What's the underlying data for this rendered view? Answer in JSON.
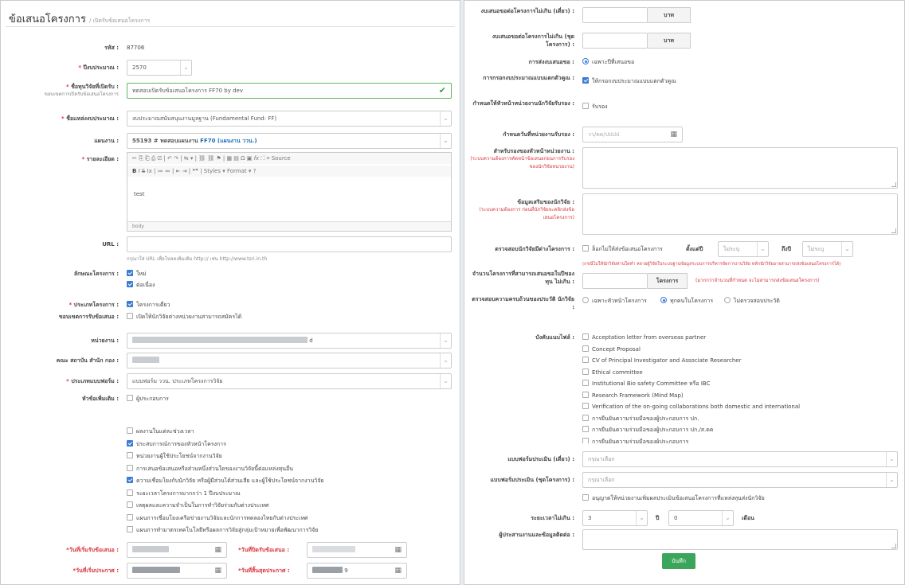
{
  "header": {
    "title": "ข้อเสนอโครงการ",
    "crumb": "/ เปิดรับข้อเสนอโครงการ"
  },
  "form": {
    "id_label": "รหัส :",
    "id_value": "87706",
    "year_label": "ปีงบประมาณ :",
    "year_value": "2570",
    "call_label": "ชื่อทุนวิจัยที่เปิดรับ :",
    "call_sublabel": "ขอบเขตการเปิดรับข้อเสนอโครงการ",
    "call_value": "ทดสอบเปิดรับข้อเสนอโครงการ FF70 by dev",
    "source_label": "ชื่อแหล่งงบประมาณ :",
    "source_value": "งบประมาณสนับสนุนงานมูลฐาน (Fundamental Fund: FF)",
    "plan_label": "แผนงาน :",
    "plan_value": "55193 # ทดสอบแผนงาน",
    "plan_code": "FF70",
    "plan_note": "(แผนงาน ววน.)",
    "detail_label": "รายละเอียด :",
    "toolbar_row1": "✂ ⎘ ⎗ ⎙ ⎚ | ↶ ↷ | ⇆ ▾ | ⛓ ⛓ ⚑ | ▦ ▤ Ω ▣",
    "fx": "fx",
    "source_btn": "⌗ Source",
    "toolbar_b": "B",
    "toolbar_i": "I",
    "toolbar_s": "S",
    "toolbar_rest": "Ix | ≔ ≕ | ⇤ ⇥ | ❝❞ |",
    "styles": "Styles",
    "format": "Format",
    "help": "?",
    "detail_value": "test",
    "detail_footer": "body",
    "url_label": "URL :",
    "url_hint": "กรุณาใส่ URL เพื่อโหลดเพิ่มเติม http:// เช่น http://www.tsri.in.th",
    "nature_label": "ลักษณะโครงการ :",
    "nature_opt1": "ใหม่",
    "nature_opt2": "ต่อเนื่อง",
    "type_label": "ประเภทโครงการ :",
    "type_value": "โครงการเดี่ยว",
    "scope_label": "ขอบเขตการรับข้อเสนอ :",
    "scope_value": "เปิดให้นักวิจัยต่างหน่วยงานสามารถสมัครได้",
    "unit_label": "หน่วยงาน :",
    "unit_suffix": "d",
    "faculty_label": "คณะ สถาบัน สำนัก กอง :",
    "form_label": "ประเภทแบบฟอร์ม :",
    "form_value": "แบบฟอร์ม ววน. ประเภทโครงการวิจัย",
    "extra_label": "หัวข้อเพิ่มเติม :",
    "extra_value": "ผู้ประกอบการ",
    "checks": [
      {
        "text": "ผลงานในแต่ละช่วงเวลา",
        "on": false
      },
      {
        "text": "ประสบการณ์การของหัวหน้าโครงการ",
        "on": true
      },
      {
        "text": "หน่วยงานผู้ใช้ประโยชน์จากงานวิจัย",
        "on": false
      },
      {
        "text": "การเสนอข้อเสนอหรือส่วนหนึ่งส่วนใดของงานวิจัยนี้ต่อแหล่งทุนอื่น",
        "on": false
      },
      {
        "text": "ความเชื่อมโยงกับนักวิจัย หรือผู้มีส่วนได้ส่วนเสีย และผู้ใช้ประโยชน์จากงานวิจัย",
        "on": true
      },
      {
        "text": "ระยะเวลาโครงการมากกว่า 1 ปีงบประมาณ",
        "on": false
      },
      {
        "text": "เหตุผลและความจำเป็นในการทำวิจัยร่วมกับต่างประเทศ",
        "on": false
      },
      {
        "text": "แผนการเชื่อมโยงเครือข่ายงานวิจัยและนักการทดลองไทยกับต่างประเทศ",
        "on": false
      },
      {
        "text": "แผนการทำมาตรเทคโนโลยีหรือผลการวิจัยสู่กลุ่มเป้าหมายเพื่อพัฒนาการวิจัย",
        "on": false
      }
    ],
    "open_label": "*วันที่เริ่มรับข้อเสนอ :",
    "close_label": "*วันที่ปิดรับข้อเสนอ :",
    "start_label": "*วันที่เริ่มประกาศ :",
    "end_label": "*วันที่สิ้นสุดประกาศ :",
    "end_suffix": "9",
    "budget1_label": "งบเสนอขอต่อโครงการไม่เกิน (เดี่ยว) :",
    "budget2_label": "งบเสนอขอต่อโครงการไม่เกิน (ชุดโครงการ) :",
    "baht": "บาท",
    "submit_label": "การส่งงบเสนอขอ :",
    "submit_value": "เฉพาะปีที่เสนอขอ",
    "multi_label": "การกรอกงบประมาณแบบแตกตัวคูณ :",
    "multi_value": "ให้กรอกงบประมาณแบบแตกตัวคูณ",
    "head_label": "กำหนดให้หัวหน้าหน่วยงานนักวิจัยรับรอง :",
    "head_value": "รับรอง",
    "certdate_label": "กำหนดวันที่หน่วยงานรับรอง :",
    "certdate_placeholder": "วว/ดด/ปปปป",
    "hunit_label": "สำหรับรองของหัวหน้าหน่วยงาน :",
    "hunit_note": "(ระบบความต้องการคัดหน้าข้อเสนอก่อนการรับรอง ของนักวิจัยหน่วยงาน)",
    "rinfo_label": "ข้อมูลเสริมของนักวิจัย :",
    "rinfo_note": "(ระบบความต้องการ ก่อนที่นักวิจัยจะคลิกส่งข้อเสนอโครงการ)",
    "dup_label": "ตรวจสอบนักวิจัยมีต่างโครงการ :",
    "dup_value": "ล็อกไม่ให้ส่งข้อเสนอโครงการ",
    "from_year": "ตั้งแต่ปี",
    "to_year": "ถึงปี",
    "select_ph": "ไม่ระบุ",
    "dup_note": "(กรณีไม่ให้นักวิจัยท่านใดทำ หลายผู้วิจัยในระบบฐานข้อมูลระบบการบริหารจัดการงานวิจัย หลักนักวิจัยอาจสามารถส่งข้อเสนอโครงการได้)",
    "count_label": "จำนวนโครงการที่สามารถเสนอขอในปีของทุน ไม่เกิน :",
    "count_btn": "โครงการ",
    "count_note": "(มากกว่าจำนวนที่กำหนด จะไม่สามารถส่งข้อเสนอโครงการ)",
    "hist_label": "ตรวจสอบความครบถ้วนของประวัติ นักวิจัย :",
    "hist_opt1": "เฉพาะหัวหน้าโครงการ",
    "hist_opt2": "ทุกคนในโครงการ",
    "hist_opt3": "ไม่ตรวจสอบประวัติ",
    "att_label": "บังคับแนบไฟล์ :",
    "attachments": [
      "Acceptation letter from overseas partner",
      "Concept Proposal",
      "CV of Principal Investigator and Associate Researcher",
      "Ethical committee",
      "Institutional Bio safety Committee หรือ IBC",
      "Research Framework (Mind Map)",
      "Verification of the on-going collaborations both domestic and international",
      "การยืนยันความร่วมมือของผู้ประกอบการ ปก.",
      "การยืนยันความร่วมมือของผู้ประกอบการ ปก./ส.ดค",
      "การยืนยันความร่วมมือของผู้ประกอบการ"
    ],
    "eval1_label": "แบบฟอร์มประเมิน (เดี่ยว) :",
    "eval2_label": "แบบฟอร์มประเมิน (ชุดโครงการ) :",
    "eval_ph": "กรุณาเลือก",
    "allow_value": "อนุญาตให้หน่วยงานเพิ่มผลประเมินข้อเสนอโครงการที่แหล่งทุนส่งนักวิจัย",
    "dur_label": "ระยะเวลาไม่เกิน :",
    "dur_year": "3",
    "dur_y_unit": "ปี",
    "dur_month": "0",
    "dur_m_unit": "เดือน",
    "coord_label": "ผู้ประสานงานและข้อมูลติดต่อ :",
    "save": "บันทึก"
  }
}
